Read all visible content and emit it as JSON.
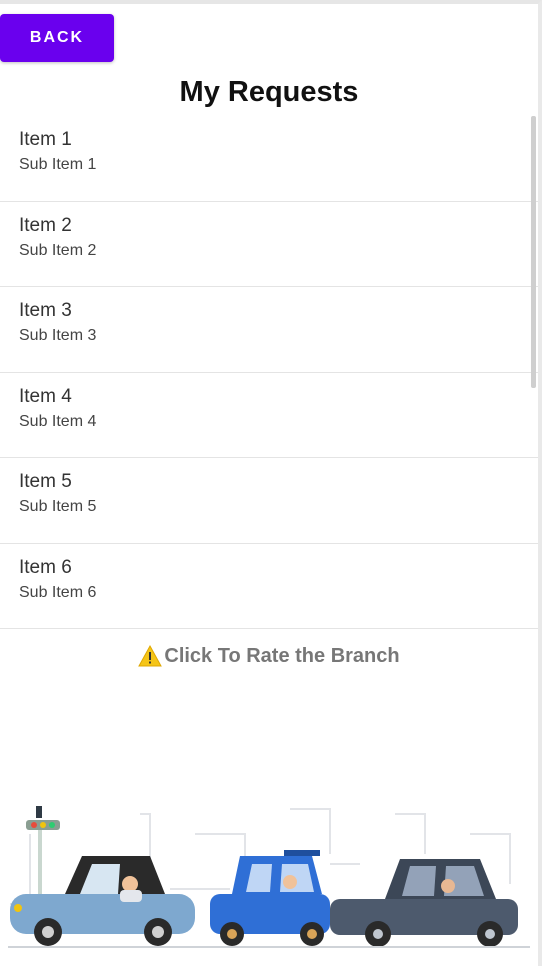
{
  "header": {
    "back_label": "BACK",
    "title": "My Requests"
  },
  "list": {
    "items": [
      {
        "label": "Item 1",
        "sub": "Sub Item 1"
      },
      {
        "label": "Item 2",
        "sub": "Sub Item 2"
      },
      {
        "label": "Item 3",
        "sub": "Sub Item 3"
      },
      {
        "label": "Item 4",
        "sub": "Sub Item 4"
      },
      {
        "label": "Item 5",
        "sub": "Sub Item 5"
      },
      {
        "label": "Item 6",
        "sub": "Sub Item 6"
      }
    ]
  },
  "rate": {
    "label": "Click To Rate the Branch",
    "icon": "warning-icon"
  },
  "colors": {
    "accent": "#6a00ee"
  }
}
